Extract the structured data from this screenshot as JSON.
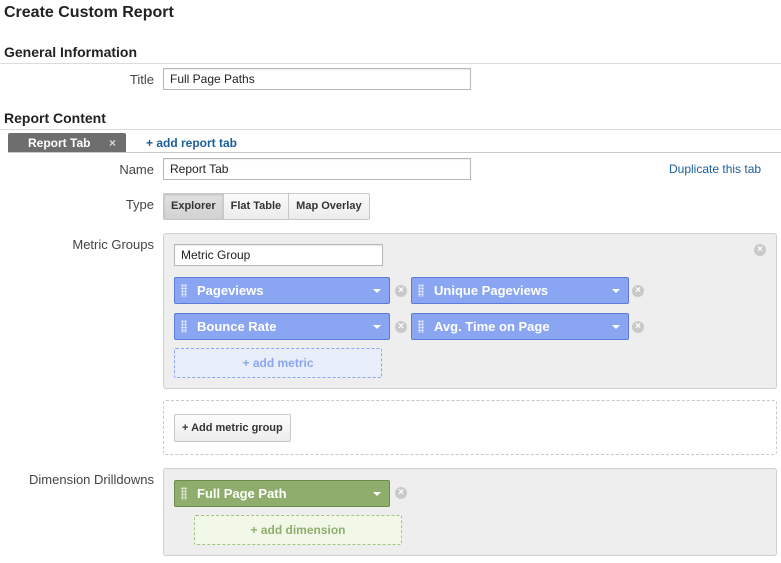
{
  "page_title": "Create Custom Report",
  "general": {
    "heading": "General Information",
    "title_label": "Title",
    "title_value": "Full Page Paths"
  },
  "content": {
    "heading": "Report Content",
    "tab_label": "Report Tab",
    "tab_close": "×",
    "add_tab": "+ add report tab",
    "name_label": "Name",
    "name_value": "Report Tab",
    "duplicate": "Duplicate this tab",
    "type_label": "Type",
    "types": [
      "Explorer",
      "Flat Table",
      "Map Overlay"
    ],
    "selected_type": "Explorer"
  },
  "metrics": {
    "label": "Metric Groups",
    "group_name": "Metric Group",
    "items": [
      "Pageviews",
      "Unique Pageviews",
      "Bounce Rate",
      "Avg. Time on Page"
    ],
    "add_metric": "+ add metric",
    "add_group": "+ Add metric group",
    "color": "#8aa6f2"
  },
  "dimensions": {
    "label": "Dimension Drilldowns",
    "items": [
      "Full Page Path"
    ],
    "add_dimension": "+ add dimension",
    "color": "#8fad6c"
  },
  "remove_glyph": "×"
}
